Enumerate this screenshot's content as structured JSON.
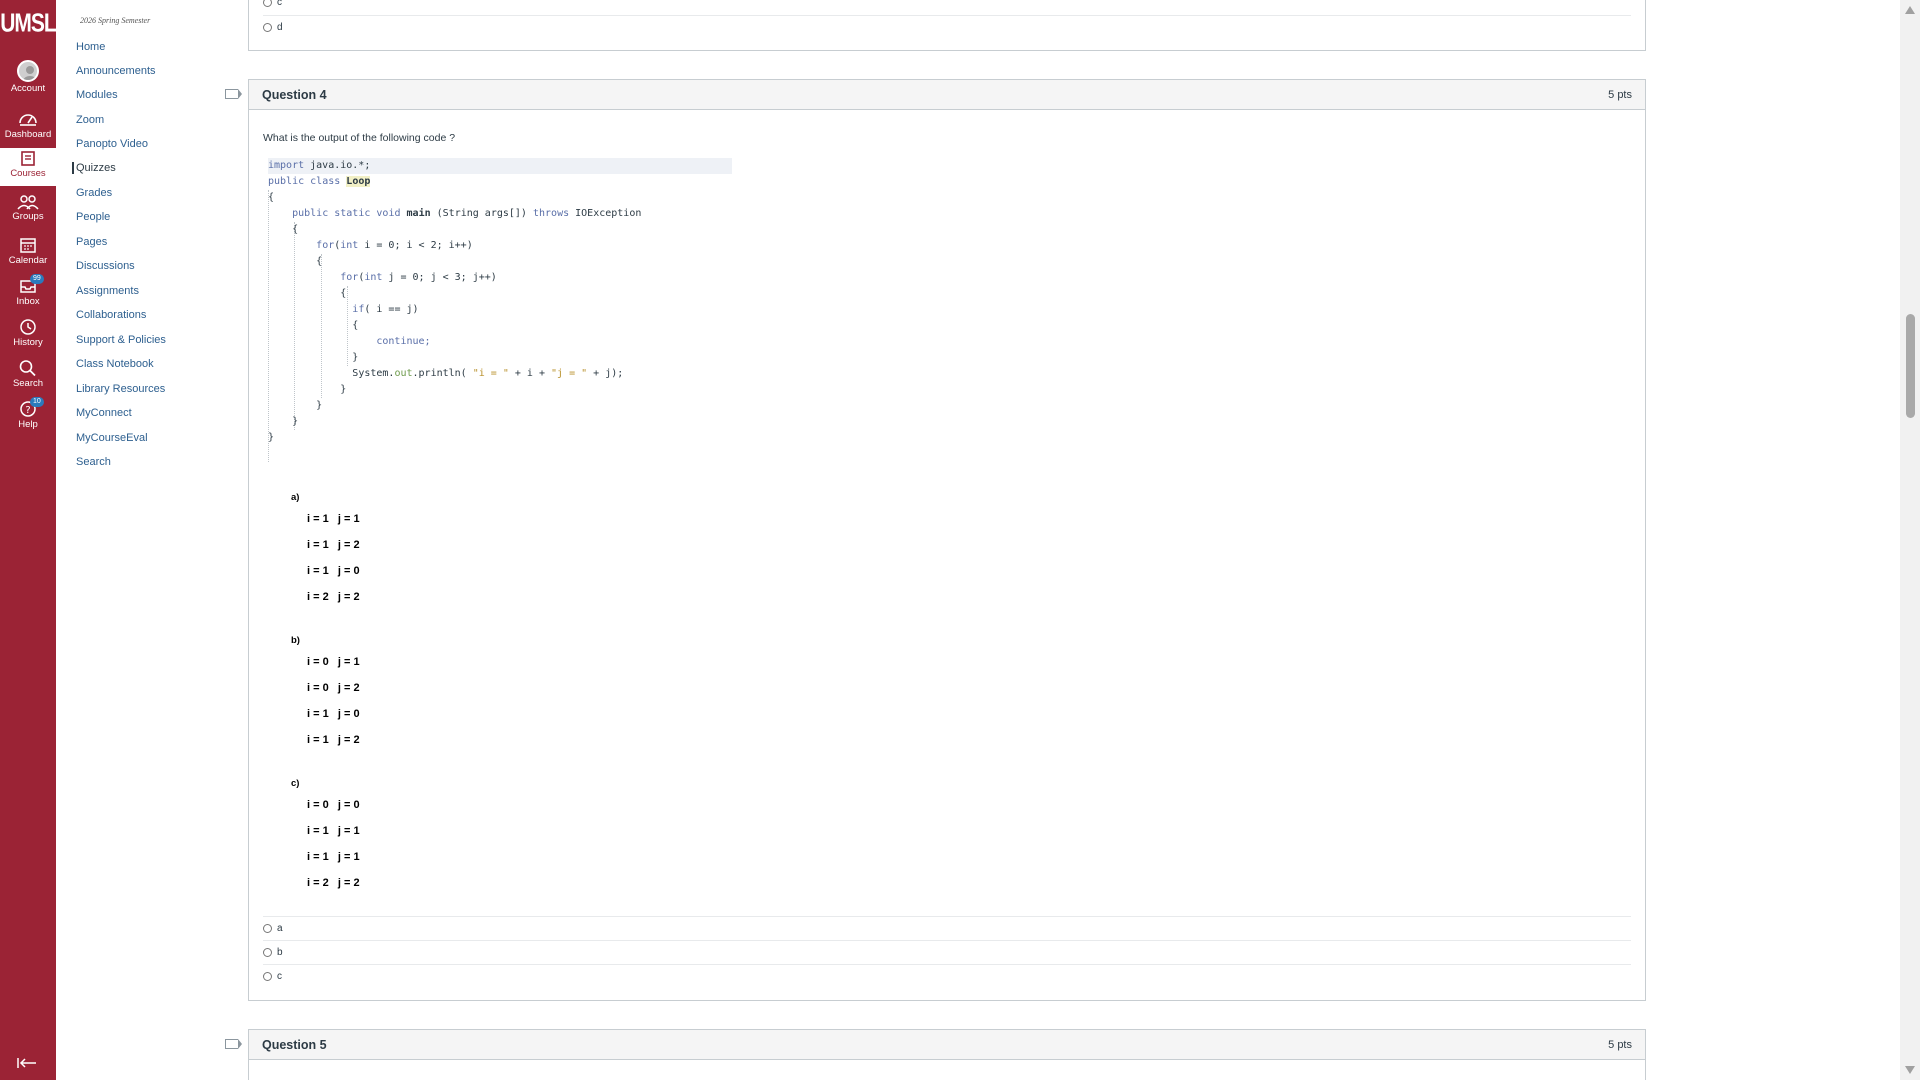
{
  "global_nav": {
    "logo": "UMSL",
    "items": [
      {
        "label": "Account",
        "icon": "account-icon"
      },
      {
        "label": "Dashboard",
        "icon": "dashboard-icon"
      },
      {
        "label": "Courses",
        "icon": "courses-icon"
      },
      {
        "label": "Groups",
        "icon": "groups-icon"
      },
      {
        "label": "Calendar",
        "icon": "calendar-icon"
      },
      {
        "label": "Inbox",
        "icon": "inbox-icon",
        "badge": "99"
      },
      {
        "label": "History",
        "icon": "history-icon"
      },
      {
        "label": "Search",
        "icon": "search-icon"
      },
      {
        "label": "Help",
        "icon": "help-icon",
        "badge": "10"
      }
    ],
    "active": "Courses",
    "brand_color": "#9b2335"
  },
  "course_nav": {
    "term": "2026 Spring Semester",
    "links": [
      "Home",
      "Announcements",
      "Modules",
      "Zoom",
      "Panopto Video",
      "Quizzes",
      "Grades",
      "People",
      "Pages",
      "Discussions",
      "Assignments",
      "Collaborations",
      "Support & Policies",
      "Class Notebook",
      "Library Resources",
      "MyConnect",
      "MyCourseEval",
      "Search"
    ],
    "active": "Quizzes"
  },
  "prev_question": {
    "answers": [
      "c",
      "d"
    ]
  },
  "question4": {
    "title": "Question 4",
    "points": "5 pts",
    "prompt": "What is the output of the following code ?",
    "code": {
      "l1a": "import",
      "l1b": " java.io.*;",
      "l2a": "public",
      "l2b": "class",
      "l2c": "Loop",
      "l3": "{",
      "l4a": "public",
      "l4b": "static",
      "l4c": "void",
      "l4d": "main",
      "l4e": " (String args[]) ",
      "l4f": "throws",
      "l4g": " IOException",
      "l5": "{",
      "l6a": "for",
      "l6b": "(",
      "l6c": "int",
      "l6d": " i = 0; i < 2; i++)",
      "l7": "{",
      "l8a": "for",
      "l8b": "(",
      "l8c": "int",
      "l8d": " j = 0; j < 3; j++)",
      "l9": "{",
      "l10a": "if",
      "l10b": "( i == j)",
      "l11": "{",
      "l12": "continue;",
      "l13": "}",
      "l14a": "System.",
      "l14b": "out",
      "l14c": ".println( ",
      "l14d": "\"i = \"",
      "l14e": " + i + ",
      "l14f": "\"j = \"",
      "l14g": " + j);",
      "l15": "}",
      "l16": "}",
      "l17": "}",
      "l18": "}"
    },
    "options": [
      {
        "letter": "a)",
        "lines": [
          "i = 1   j = 1",
          "i = 1   j = 2",
          "i = 1   j = 0",
          "i = 2   j = 2"
        ]
      },
      {
        "letter": "b)",
        "lines": [
          "i = 0   j = 1",
          "i = 0   j = 2",
          "i = 1   j = 0",
          "i = 1   j = 2"
        ]
      },
      {
        "letter": "c)",
        "lines": [
          "i = 0   j = 0",
          "i = 1   j = 1",
          "i = 1   j = 1",
          "i = 2   j = 2"
        ]
      }
    ],
    "answers": [
      "a",
      "b",
      "c"
    ]
  },
  "question5": {
    "title": "Question 5",
    "points": "5 pts"
  }
}
